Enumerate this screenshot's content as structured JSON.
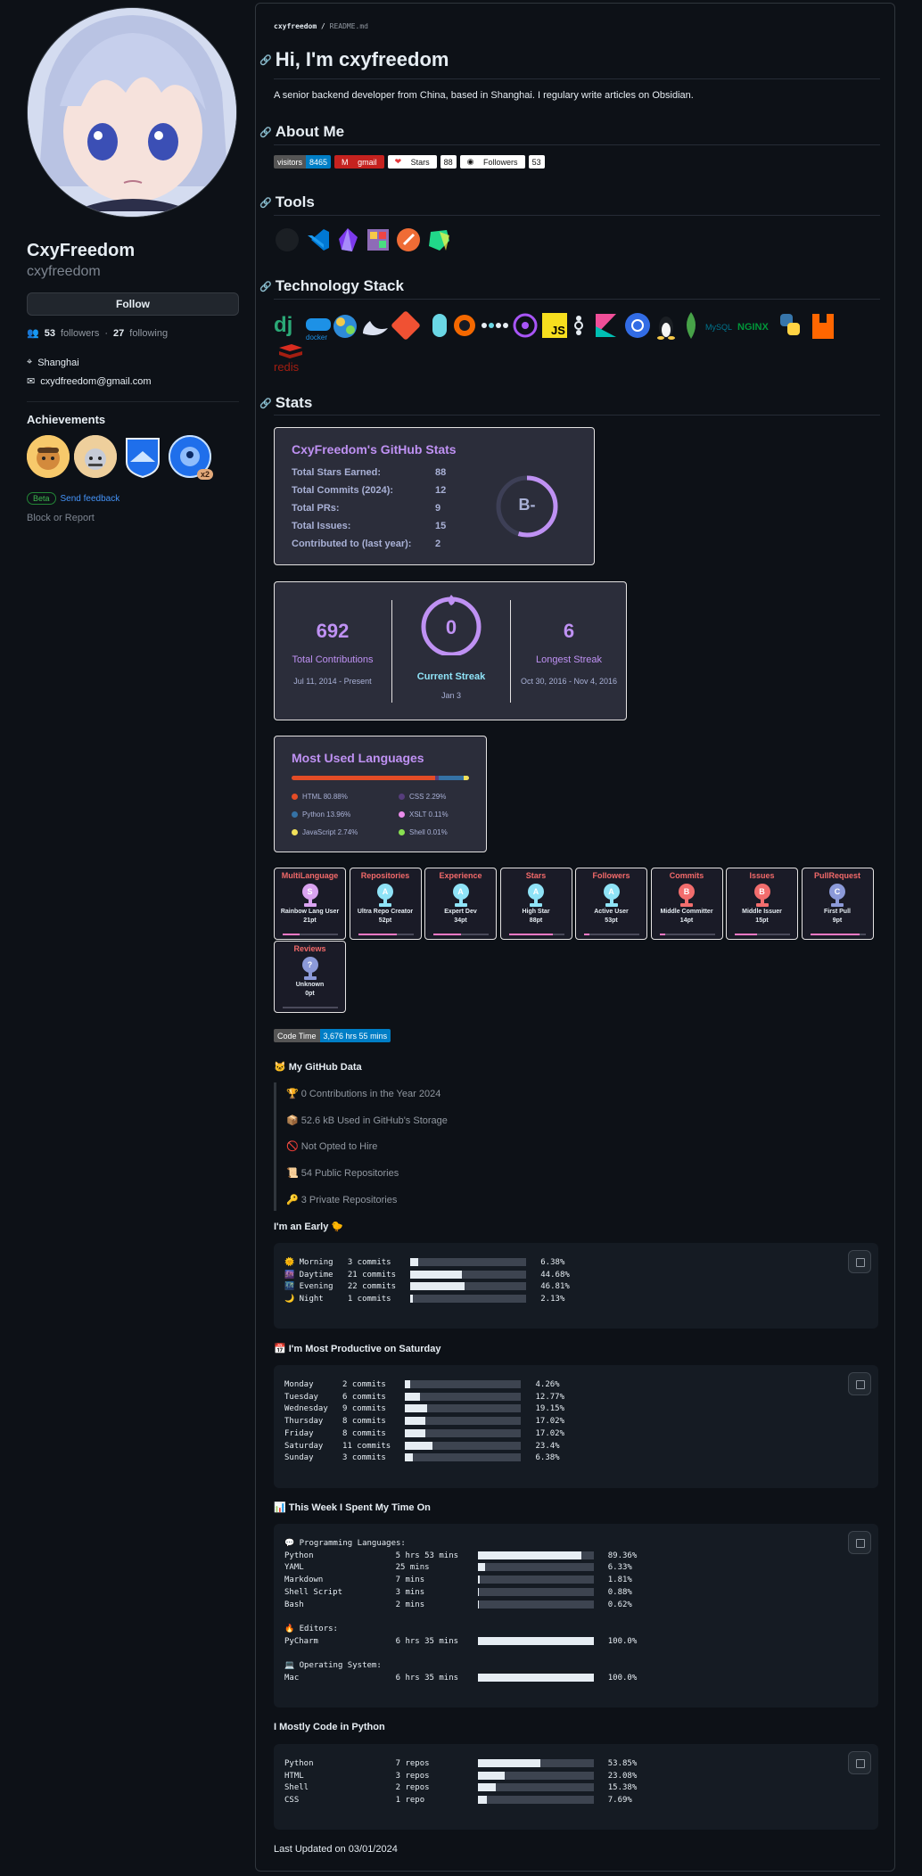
{
  "profile": {
    "name": "CxyFreedom",
    "login": "cxyfreedom",
    "follow_label": "Follow",
    "followers": "53",
    "followers_label": "followers",
    "following": "27",
    "following_label": "following",
    "location": "Shanghai",
    "email": "cxydfreedom@gmail.com"
  },
  "achievements": {
    "title": "Achievements",
    "multiplier": "x2",
    "beta": "Beta",
    "feedback": "Send feedback",
    "block": "Block or Report"
  },
  "readme": {
    "crumb_user": "cxyfreedom",
    "crumb_file": "README.md",
    "title": "Hi, I'm cxyfreedom",
    "intro": "A senior backend developer from China, based in Shanghai. I regulary write articles on Obsidian.",
    "about": "About Me",
    "tools": "Tools",
    "tech": "Technology Stack",
    "stats": "Stats"
  },
  "shields": {
    "visitors_l": "visitors",
    "visitors_v": "8465",
    "gmail": "gmail",
    "stars_l": "Stars",
    "stars_v": "88",
    "followers_l": "Followers",
    "followers_v": "53",
    "codetime_l": "Code Time",
    "codetime_v": "3,676 hrs 55 mins"
  },
  "github_stats": {
    "title": "CxyFreedom's GitHub Stats",
    "rows": [
      {
        "label": "Total Stars Earned:",
        "value": "88"
      },
      {
        "label": "Total Commits (2024):",
        "value": "12"
      },
      {
        "label": "Total PRs:",
        "value": "9"
      },
      {
        "label": "Total Issues:",
        "value": "15"
      },
      {
        "label": "Contributed to (last year):",
        "value": "2"
      }
    ],
    "grade": "B-"
  },
  "streak": {
    "total": "692",
    "total_label": "Total Contributions",
    "total_range": "Jul 11, 2014 - Present",
    "current": "0",
    "current_label": "Current Streak",
    "current_date": "Jan 3",
    "longest": "6",
    "longest_label": "Longest Streak",
    "longest_range": "Oct 30, 2016 - Nov 4, 2016"
  },
  "languages": {
    "title": "Most Used Languages",
    "items": [
      {
        "name": "HTML 80.88%",
        "color": "#e34c26",
        "pct": 80.88
      },
      {
        "name": "CSS 2.29%",
        "color": "#563d7c",
        "pct": 2.29
      },
      {
        "name": "Python 13.96%",
        "color": "#3572a5",
        "pct": 13.96
      },
      {
        "name": "XSLT 0.11%",
        "color": "#eb8ceb",
        "pct": 0.11
      },
      {
        "name": "JavaScript 2.74%",
        "color": "#f1e05a",
        "pct": 2.74
      },
      {
        "name": "Shell 0.01%",
        "color": "#89e051",
        "pct": 0.01
      }
    ]
  },
  "trophies": [
    {
      "title": "MultiLanguage",
      "rank": "S",
      "label": "Rainbow Lang User",
      "pts": "21pt",
      "color": "#d9a3f0",
      "prog": 0.3
    },
    {
      "title": "Repositories",
      "rank": "A",
      "label": "Ultra Repo Creator",
      "pts": "52pt",
      "color": "#8fe3f7",
      "prog": 0.7
    },
    {
      "title": "Experience",
      "rank": "A",
      "label": "Expert Dev",
      "pts": "34pt",
      "color": "#8fe3f7",
      "prog": 0.5
    },
    {
      "title": "Stars",
      "rank": "A",
      "label": "High Star",
      "pts": "88pt",
      "color": "#8fe3f7",
      "prog": 0.8
    },
    {
      "title": "Followers",
      "rank": "A",
      "label": "Active User",
      "pts": "53pt",
      "color": "#8fe3f7",
      "prog": 0.1
    },
    {
      "title": "Commits",
      "rank": "B",
      "label": "Middle Committer",
      "pts": "14pt",
      "color": "#f26d6d",
      "prog": 0.1
    },
    {
      "title": "Issues",
      "rank": "B",
      "label": "Middle Issuer",
      "pts": "15pt",
      "color": "#f26d6d",
      "prog": 0.4
    },
    {
      "title": "PullRequest",
      "rank": "C",
      "label": "First Pull",
      "pts": "9pt",
      "color": "#8c9ad9",
      "prog": 0.9
    },
    {
      "title": "Reviews",
      "rank": "?",
      "label": "Unknown",
      "pts": "0pt",
      "color": "#8c9ad9",
      "prog": 0
    }
  ],
  "github_data": {
    "title": "🐱 My GitHub Data",
    "items": [
      "🏆 0 Contributions in the Year 2024",
      "📦 52.6 kB Used in GitHub's Storage",
      "🚫 Not Opted to Hire",
      "📜 54 Public Repositories",
      "🔑 3 Private Repositories"
    ]
  },
  "early": {
    "title": "I'm an Early 🐤",
    "rows": [
      {
        "label": "🌞 Morning",
        "count": "3 commits",
        "pct": "6.38%",
        "f": 0.0638
      },
      {
        "label": "🌆 Daytime",
        "count": "21 commits",
        "pct": "44.68%",
        "f": 0.4468
      },
      {
        "label": "🌃 Evening",
        "count": "22 commits",
        "pct": "46.81%",
        "f": 0.4681
      },
      {
        "label": "🌙 Night",
        "count": "1 commits",
        "pct": "2.13%",
        "f": 0.0213
      }
    ]
  },
  "weekday": {
    "title": "📅 I'm Most Productive on Saturday",
    "rows": [
      {
        "label": "Monday",
        "count": "2 commits",
        "pct": "4.26%",
        "f": 0.0426
      },
      {
        "label": "Tuesday",
        "count": "6 commits",
        "pct": "12.77%",
        "f": 0.1277
      },
      {
        "label": "Wednesday",
        "count": "9 commits",
        "pct": "19.15%",
        "f": 0.1915
      },
      {
        "label": "Thursday",
        "count": "8 commits",
        "pct": "17.02%",
        "f": 0.1702
      },
      {
        "label": "Friday",
        "count": "8 commits",
        "pct": "17.02%",
        "f": 0.1702
      },
      {
        "label": "Saturday",
        "count": "11 commits",
        "pct": "23.4%",
        "f": 0.234
      },
      {
        "label": "Sunday",
        "count": "3 commits",
        "pct": "6.38%",
        "f": 0.0638
      }
    ]
  },
  "week": {
    "title": "📊 This Week I Spent My Time On",
    "lang_title": "💬 Programming Languages:",
    "langs": [
      {
        "label": "Python",
        "time": "5 hrs 53 mins",
        "pct": "89.36%",
        "f": 0.8936
      },
      {
        "label": "YAML",
        "time": "25 mins",
        "pct": "6.33%",
        "f": 0.0633
      },
      {
        "label": "Markdown",
        "time": "7 mins",
        "pct": "1.81%",
        "f": 0.0181
      },
      {
        "label": "Shell Script",
        "time": "3 mins",
        "pct": "0.88%",
        "f": 0.0088
      },
      {
        "label": "Bash",
        "time": "2 mins",
        "pct": "0.62%",
        "f": 0.0062
      }
    ],
    "editor_title": "🔥 Editors:",
    "editors": [
      {
        "label": "PyCharm",
        "time": "6 hrs 35 mins",
        "pct": "100.0%",
        "f": 1
      }
    ],
    "os_title": "💻 Operating System:",
    "os": [
      {
        "label": "Mac",
        "time": "6 hrs 35 mins",
        "pct": "100.0%",
        "f": 1
      }
    ]
  },
  "mostly": {
    "title": "I Mostly Code in Python",
    "rows": [
      {
        "label": "Python",
        "count": "7 repos",
        "pct": "53.85%",
        "f": 0.5385
      },
      {
        "label": "HTML",
        "count": "3 repos",
        "pct": "23.08%",
        "f": 0.2308
      },
      {
        "label": "Shell",
        "count": "2 repos",
        "pct": "15.38%",
        "f": 0.1538
      },
      {
        "label": "CSS",
        "count": "1 repo",
        "pct": "7.69%",
        "f": 0.0769
      }
    ]
  },
  "updated": "Last Updated on 03/01/2024"
}
